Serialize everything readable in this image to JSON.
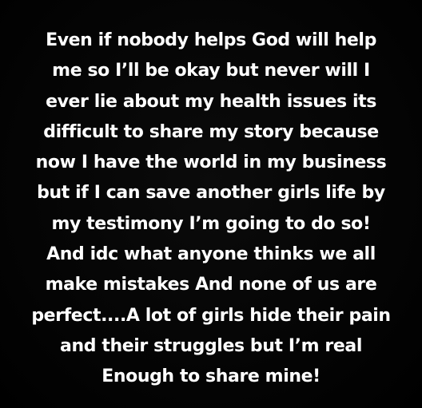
{
  "story": {
    "lines": [
      "Even if nobody helps God will help",
      "me so I’ll be okay but never will I",
      "ever lie about my health issues its",
      "difficult to share my story because",
      "now I have the world in my business",
      "but if I can save another girls life by",
      "my testimony I’m going to do so!",
      "And idc what anyone thinks we all",
      "make mistakes And none of us are",
      "perfect....A lot of girls hide their pain",
      "and their struggles but I’m real",
      "Enough to share mine!"
    ]
  },
  "colors": {
    "background": "#000000",
    "text": "#ffffff"
  }
}
